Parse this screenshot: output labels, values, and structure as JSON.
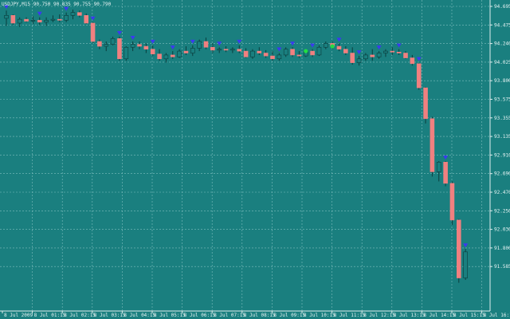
{
  "chart_data": {
    "type": "candlestick",
    "symbol_header": "USDJPY,M15  90.750 90.835 90.755 90.790",
    "y_range": [
      91.656,
      94.68
    ],
    "y_ticks": [
      "94.695",
      "94.475",
      "94.240",
      "94.025",
      "93.800",
      "93.575",
      "93.355",
      "93.135",
      "92.910",
      "92.690",
      "92.470",
      "92.250",
      "92.030",
      "91.800",
      "91.585"
    ],
    "x_labels": [
      "8 Jul 2009",
      "8 Jul 01:15",
      "8 Jul 02:15",
      "8 Jul 03:15",
      "8 Jul 04:15",
      "8 Jul 05:15",
      "8 Jul 06:15",
      "8 Jul 07:15",
      "8 Jul 08:15",
      "8 Jul 09:15",
      "8 Jul 10:15",
      "8 Jul 11:15",
      "8 Jul 12:15",
      "8 Jul 13:15",
      "8 Jul 14:15",
      "8 Jul 15:15",
      "8 Jul 16:15"
    ],
    "grid": true,
    "colors": {
      "background": "#1a7f7f",
      "grid": "#7fbfbf",
      "bull": "#1a7f7f",
      "bear": "#f08080",
      "wick": "#0b3d3d",
      "marker_blue": "#3a3af0",
      "marker_green": "#22dd44",
      "text": "#e8f4f4"
    },
    "candles": [
      {
        "o": 94.54,
        "h": 94.62,
        "l": 94.46,
        "c": 94.57
      },
      {
        "o": 94.57,
        "h": 94.58,
        "l": 94.47,
        "c": 94.49
      },
      {
        "o": 94.49,
        "h": 94.55,
        "l": 94.45,
        "c": 94.53
      },
      {
        "o": 94.53,
        "h": 94.55,
        "l": 94.5,
        "c": 94.51
      },
      {
        "o": 94.51,
        "h": 94.56,
        "l": 94.48,
        "c": 94.52
      },
      {
        "o": 94.52,
        "h": 94.55,
        "l": 94.47,
        "c": 94.5
      },
      {
        "o": 94.5,
        "h": 94.55,
        "l": 94.46,
        "c": 94.52
      },
      {
        "o": 94.52,
        "h": 94.57,
        "l": 94.5,
        "c": 94.53
      },
      {
        "o": 94.53,
        "h": 94.58,
        "l": 94.5,
        "c": 94.52
      },
      {
        "o": 94.52,
        "h": 94.6,
        "l": 94.5,
        "c": 94.57
      },
      {
        "o": 94.57,
        "h": 94.63,
        "l": 94.53,
        "c": 94.6
      },
      {
        "o": 94.6,
        "h": 94.62,
        "l": 94.55,
        "c": 94.57
      },
      {
        "o": 94.57,
        "h": 94.59,
        "l": 94.48,
        "c": 94.49
      },
      {
        "o": 94.49,
        "h": 94.5,
        "l": 94.28,
        "c": 94.3
      },
      {
        "o": 94.3,
        "h": 94.32,
        "l": 94.22,
        "c": 94.25
      },
      {
        "o": 94.25,
        "h": 94.3,
        "l": 94.2,
        "c": 94.27
      },
      {
        "o": 94.27,
        "h": 94.35,
        "l": 94.26,
        "c": 94.33
      },
      {
        "o": 94.33,
        "h": 94.35,
        "l": 94.1,
        "c": 94.12
      },
      {
        "o": 94.12,
        "h": 94.25,
        "l": 94.1,
        "c": 94.24
      },
      {
        "o": 94.24,
        "h": 94.3,
        "l": 94.2,
        "c": 94.27
      },
      {
        "o": 94.27,
        "h": 94.3,
        "l": 94.22,
        "c": 94.25
      },
      {
        "o": 94.25,
        "h": 94.28,
        "l": 94.18,
        "c": 94.22
      },
      {
        "o": 94.22,
        "h": 94.26,
        "l": 94.15,
        "c": 94.17
      },
      {
        "o": 94.17,
        "h": 94.22,
        "l": 94.1,
        "c": 94.12
      },
      {
        "o": 94.12,
        "h": 94.18,
        "l": 94.08,
        "c": 94.16
      },
      {
        "o": 94.16,
        "h": 94.2,
        "l": 94.12,
        "c": 94.14
      },
      {
        "o": 94.14,
        "h": 94.22,
        "l": 94.13,
        "c": 94.2
      },
      {
        "o": 94.2,
        "h": 94.25,
        "l": 94.16,
        "c": 94.18
      },
      {
        "o": 94.18,
        "h": 94.26,
        "l": 94.15,
        "c": 94.23
      },
      {
        "o": 94.23,
        "h": 94.32,
        "l": 94.2,
        "c": 94.3
      },
      {
        "o": 94.3,
        "h": 94.34,
        "l": 94.22,
        "c": 94.24
      },
      {
        "o": 94.24,
        "h": 94.28,
        "l": 94.18,
        "c": 94.21
      },
      {
        "o": 94.21,
        "h": 94.24,
        "l": 94.18,
        "c": 94.22
      },
      {
        "o": 94.22,
        "h": 94.25,
        "l": 94.19,
        "c": 94.21
      },
      {
        "o": 94.21,
        "h": 94.24,
        "l": 94.18,
        "c": 94.22
      },
      {
        "o": 94.22,
        "h": 94.26,
        "l": 94.18,
        "c": 94.2
      },
      {
        "o": 94.2,
        "h": 94.23,
        "l": 94.13,
        "c": 94.14
      },
      {
        "o": 94.14,
        "h": 94.22,
        "l": 94.12,
        "c": 94.2
      },
      {
        "o": 94.2,
        "h": 94.24,
        "l": 94.16,
        "c": 94.18
      },
      {
        "o": 94.18,
        "h": 94.21,
        "l": 94.13,
        "c": 94.15
      },
      {
        "o": 94.15,
        "h": 94.2,
        "l": 94.1,
        "c": 94.12
      },
      {
        "o": 94.12,
        "h": 94.18,
        "l": 94.1,
        "c": 94.16
      },
      {
        "o": 94.16,
        "h": 94.24,
        "l": 94.14,
        "c": 94.22
      },
      {
        "o": 94.22,
        "h": 94.24,
        "l": 94.14,
        "c": 94.16
      },
      {
        "o": 94.16,
        "h": 94.2,
        "l": 94.13,
        "c": 94.15
      },
      {
        "o": 94.15,
        "h": 94.22,
        "l": 94.14,
        "c": 94.2
      },
      {
        "o": 94.2,
        "h": 94.22,
        "l": 94.14,
        "c": 94.16
      },
      {
        "o": 94.16,
        "h": 94.26,
        "l": 94.15,
        "c": 94.24
      },
      {
        "o": 94.24,
        "h": 94.3,
        "l": 94.22,
        "c": 94.28
      },
      {
        "o": 94.28,
        "h": 94.3,
        "l": 94.22,
        "c": 94.25
      },
      {
        "o": 94.25,
        "h": 94.28,
        "l": 94.2,
        "c": 94.22
      },
      {
        "o": 94.22,
        "h": 94.25,
        "l": 94.16,
        "c": 94.18
      },
      {
        "o": 94.18,
        "h": 94.24,
        "l": 94.06,
        "c": 94.08
      },
      {
        "o": 94.08,
        "h": 94.15,
        "l": 94.05,
        "c": 94.12
      },
      {
        "o": 94.12,
        "h": 94.18,
        "l": 94.1,
        "c": 94.16
      },
      {
        "o": 94.16,
        "h": 94.22,
        "l": 94.1,
        "c": 94.14
      },
      {
        "o": 94.14,
        "h": 94.2,
        "l": 94.12,
        "c": 94.18
      },
      {
        "o": 94.18,
        "h": 94.22,
        "l": 94.14,
        "c": 94.2
      },
      {
        "o": 94.2,
        "h": 94.24,
        "l": 94.16,
        "c": 94.19
      },
      {
        "o": 94.19,
        "h": 94.22,
        "l": 94.16,
        "c": 94.18
      },
      {
        "o": 94.18,
        "h": 94.2,
        "l": 94.12,
        "c": 94.13
      },
      {
        "o": 94.13,
        "h": 94.16,
        "l": 94.05,
        "c": 94.07
      },
      {
        "o": 94.07,
        "h": 94.08,
        "l": 93.8,
        "c": 93.82
      },
      {
        "o": 93.82,
        "h": 93.83,
        "l": 93.45,
        "c": 93.5
      },
      {
        "o": 93.5,
        "h": 93.52,
        "l": 92.9,
        "c": 92.95
      },
      {
        "o": 92.95,
        "h": 93.06,
        "l": 92.85,
        "c": 93.05
      },
      {
        "o": 93.05,
        "h": 93.06,
        "l": 92.8,
        "c": 92.83
      },
      {
        "o": 92.83,
        "h": 92.85,
        "l": 92.4,
        "c": 92.45
      },
      {
        "o": 92.45,
        "h": 92.46,
        "l": 91.8,
        "c": 91.85
      },
      {
        "o": 91.85,
        "h": 92.15,
        "l": 91.83,
        "c": 92.12
      }
    ],
    "blue_markers": [
      0,
      5,
      9,
      13,
      17,
      19,
      22,
      25,
      28,
      32,
      35,
      41,
      43,
      46,
      50,
      53,
      56,
      59,
      62,
      66,
      69
    ],
    "green_markers": [
      45,
      49
    ]
  }
}
